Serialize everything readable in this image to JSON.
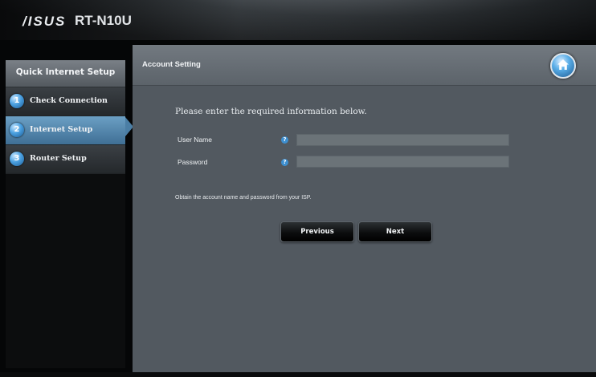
{
  "header": {
    "brand": "/ISUS",
    "model": "RT-N10U"
  },
  "sidebar": {
    "title": "Quick Internet Setup",
    "items": [
      {
        "num": "1",
        "label": "Check Connection",
        "active": false
      },
      {
        "num": "2",
        "label": "Internet Setup",
        "active": true
      },
      {
        "num": "3",
        "label": "Router Setup",
        "active": false
      }
    ]
  },
  "panel": {
    "title": "Account Setting",
    "intro": "Please enter the required information below.",
    "fields": [
      {
        "label": "User Name",
        "help": "?",
        "value": ""
      },
      {
        "label": "Password",
        "help": "?",
        "value": ""
      }
    ],
    "note": "Obtain the account name and password from your ISP.",
    "buttons": {
      "previous": "Previous",
      "next": "Next"
    }
  },
  "colors": {
    "accent": "#4aa0e0",
    "active_item": "#5a8fb6",
    "panel_bg": "#525960"
  },
  "icons": {
    "home": "home-icon",
    "help": "help-icon"
  }
}
